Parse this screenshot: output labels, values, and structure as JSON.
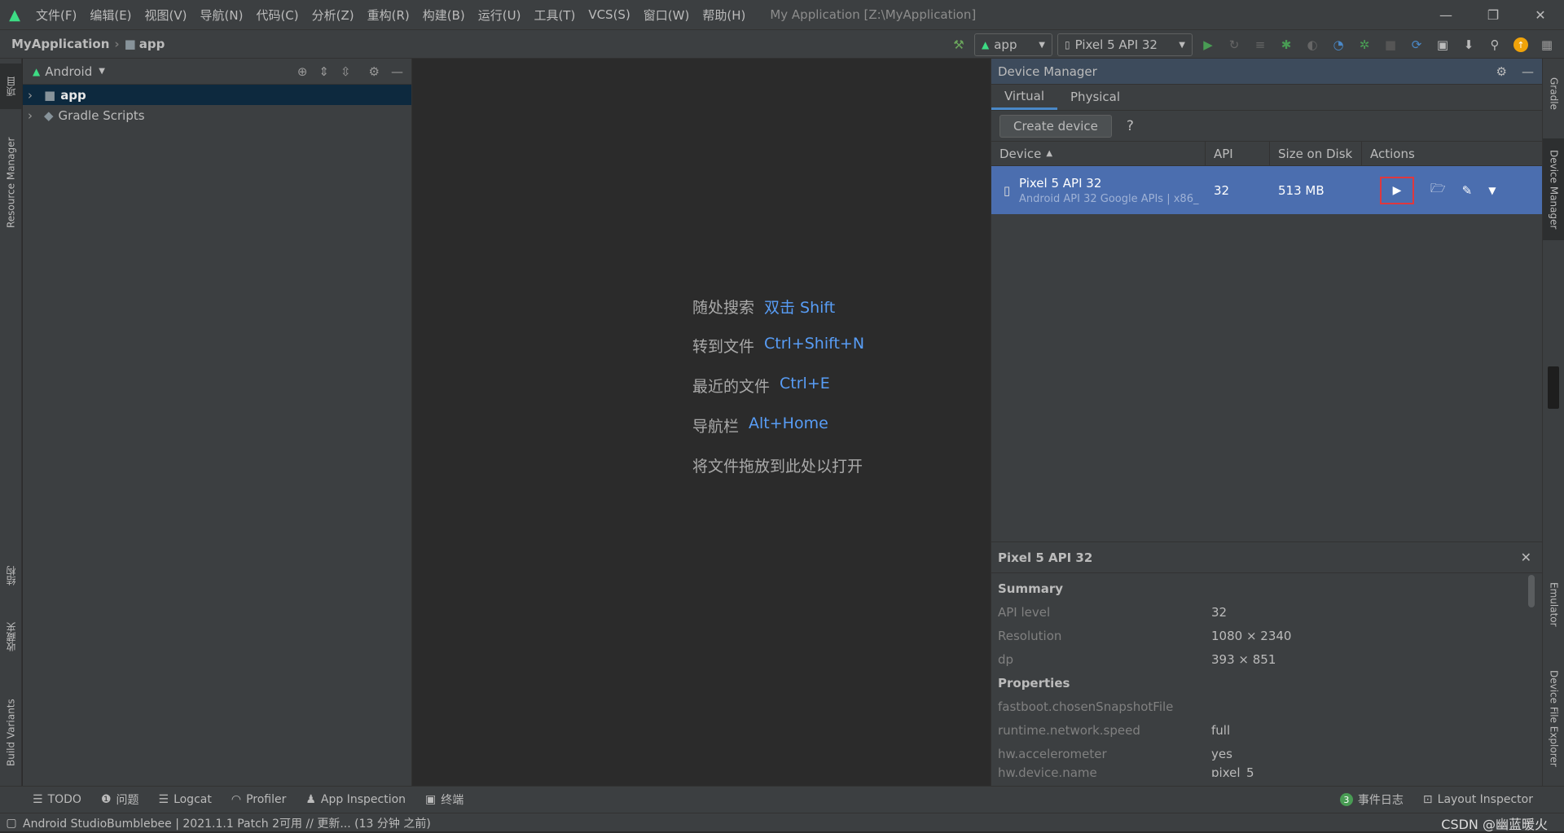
{
  "titlebar": {
    "menu": [
      "文件(F)",
      "编辑(E)",
      "视图(V)",
      "导航(N)",
      "代码(C)",
      "分析(Z)",
      "重构(R)",
      "构建(B)",
      "运行(U)",
      "工具(T)",
      "VCS(S)",
      "窗口(W)",
      "帮助(H)"
    ],
    "window_title": "My Application [Z:\\MyApplication]"
  },
  "navbar": {
    "project": "MyApplication",
    "module": "app",
    "run_config": "app",
    "device": "Pixel 5 API 32"
  },
  "left_strip": {
    "project_tab": "项目",
    "resource_manager": "Resource Manager",
    "structure": "结构",
    "favorites": "收藏夹",
    "build_variants": "Build Variants"
  },
  "right_strip": {
    "gradle": "Gradle",
    "device_manager": "Device Manager",
    "emulator": "Emulator",
    "device_file_explorer": "Device File Explorer"
  },
  "project_panel": {
    "view": "Android",
    "items": [
      {
        "label": "app"
      },
      {
        "label": "Gradle Scripts"
      }
    ]
  },
  "editor": {
    "hints": [
      {
        "label": "随处搜索",
        "key": "双击 Shift"
      },
      {
        "label": "转到文件",
        "key": "Ctrl+Shift+N"
      },
      {
        "label": "最近的文件",
        "key": "Ctrl+E"
      },
      {
        "label": "导航栏",
        "key": "Alt+Home"
      },
      {
        "label": "将文件拖放到此处以打开",
        "key": ""
      }
    ]
  },
  "device_manager": {
    "title": "Device Manager",
    "tabs": [
      "Virtual",
      "Physical"
    ],
    "create_device": "Create device",
    "help": "?",
    "columns": [
      "Device",
      "API",
      "Size on Disk",
      "Actions"
    ],
    "device": {
      "name": "Pixel 5 API 32",
      "subtitle": "Android API 32 Google APIs | x86_",
      "api": "32",
      "size": "513 MB"
    },
    "detail": {
      "title": "Pixel 5 API 32",
      "summary_label": "Summary",
      "summary": [
        {
          "k": "API level",
          "v": "32"
        },
        {
          "k": "Resolution",
          "v": "1080 × 2340"
        },
        {
          "k": "dp",
          "v": "393 × 851"
        }
      ],
      "properties_label": "Properties",
      "properties": [
        {
          "k": "fastboot.chosenSnapshotFile",
          "v": ""
        },
        {
          "k": "runtime.network.speed",
          "v": "full"
        },
        {
          "k": "hw.accelerometer",
          "v": "yes"
        },
        {
          "k": "hw.device.name",
          "v": "pixel_5"
        }
      ]
    }
  },
  "bottom": {
    "tabs": [
      "TODO",
      "问题",
      "Logcat",
      "Profiler",
      "App Inspection",
      "终端"
    ],
    "event_log_count": "3",
    "event_log": "事件日志",
    "layout_inspector": "Layout Inspector",
    "status": "Android StudioBumblebee | 2021.1.1 Patch 2可用 // 更新... (13 分钟 之前)",
    "watermark": "CSDN @幽蓝暖火"
  },
  "colors": {
    "accent": "#4b6eaf",
    "link": "#589df6",
    "highlight": "#e0383e"
  }
}
